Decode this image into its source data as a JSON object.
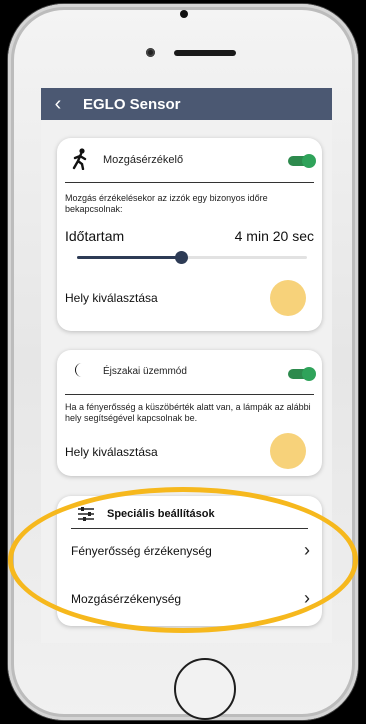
{
  "header": {
    "back_icon": "chevron-left-icon",
    "title": "EGLO Sensor"
  },
  "motion": {
    "title": "Mozgásérzékelő",
    "icon": "walking-person-icon",
    "toggle_on": true,
    "description": "Mozgás érzékelésekor az izzók egy bizonyos időre bekapcsolnak:",
    "duration_label": "Időtartam",
    "duration_value": "4 min 20 sec",
    "slider_level": 0.45,
    "location_label": "Hely kiválasztása",
    "location_color": "#f7d27a"
  },
  "night": {
    "title": "Éjszakai üzemmód",
    "icon": "crescent-moon-icon",
    "toggle_on": true,
    "description": "Ha a fényerősség a küszöbérték alatt van, a lámpák az alábbi hely segítségével kapcsolnak be.",
    "location_label": "Hely kiválasztása",
    "location_color": "#f7d27a"
  },
  "special": {
    "icon": "sliders-icon",
    "title": "Speciális beállítások",
    "items": [
      {
        "label": "Fényerősség érzékenység"
      },
      {
        "label": "Mozgásérzékenység"
      }
    ]
  },
  "colors": {
    "topbar": "#4b5872",
    "toggle": "#2fa35a",
    "accent_highlight": "#f6b81d"
  }
}
